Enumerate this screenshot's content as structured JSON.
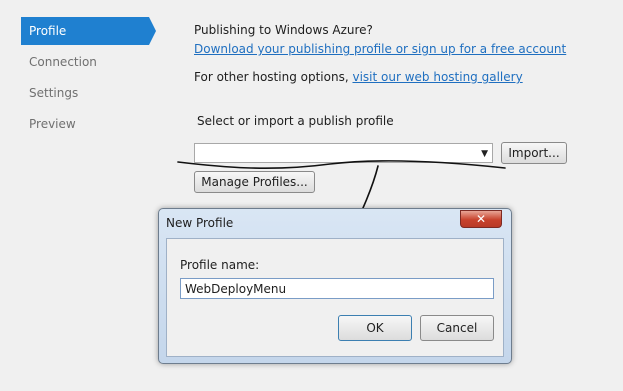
{
  "sidebar": {
    "items": [
      {
        "label": "Profile",
        "active": true
      },
      {
        "label": "Connection",
        "active": false
      },
      {
        "label": "Settings",
        "active": false
      },
      {
        "label": "Preview",
        "active": false
      }
    ]
  },
  "profile": {
    "heading": "Publishing to Windows Azure?",
    "download_link": "Download your publishing profile or sign up for a free account",
    "other_hosting_text": "For other hosting options,",
    "gallery_link": "visit our web hosting gallery",
    "select_label": "Select or import a publish profile",
    "profile_select_value": "",
    "import_button": "Import...",
    "manage_button": "Manage Profiles..."
  },
  "dialog": {
    "title": "New Profile",
    "close_glyph": "✕",
    "field_label": "Profile name:",
    "field_value": "WebDeployMenu",
    "ok_button": "OK",
    "cancel_button": "Cancel"
  },
  "colors": {
    "accent": "#1f80d0",
    "link": "#1f6fc0",
    "background": "#f0f0f0",
    "close_button": "#c8422d"
  },
  "annotation": {
    "description_icons": [
      "scribble-underline",
      "arrow-down-icon"
    ]
  }
}
